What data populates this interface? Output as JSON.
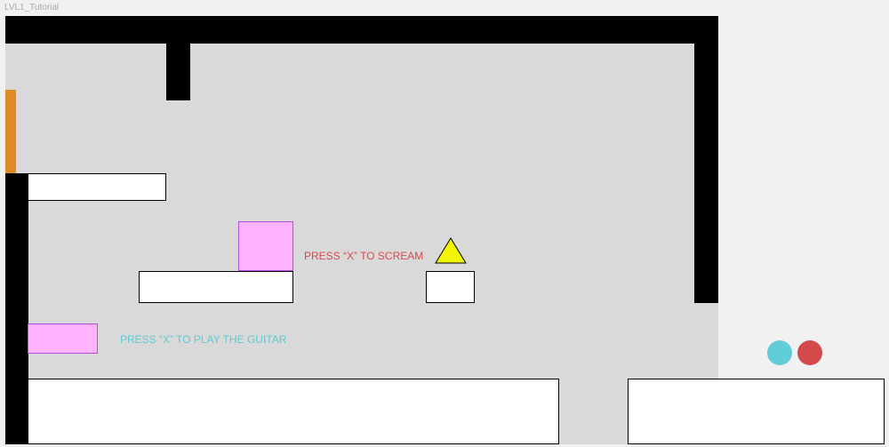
{
  "window": {
    "title": "LVL1_Tutorial"
  },
  "hints": {
    "scream": "PRESS “X” TO SCREAM",
    "guitar": "PRESS “X” TO PLAY THE GUITAR"
  },
  "colors": {
    "background": "#f1f1f1",
    "level_floor": "#d9d9d9",
    "wall": "#000000",
    "platform": "#ffffff",
    "pink_block": "#ffb3ff",
    "pink_border": "#b04ee0",
    "door": "#e08a24",
    "triangle": "#f1f500",
    "hint_red": "#d84a4a",
    "hint_cyan": "#5ecbd2",
    "player_cyan": "#61cdd6",
    "player_red": "#d24a4a"
  },
  "players": [
    {
      "name": "cyan-player",
      "color": "#61cdd6"
    },
    {
      "name": "red-player",
      "color": "#d24a4a"
    }
  ]
}
